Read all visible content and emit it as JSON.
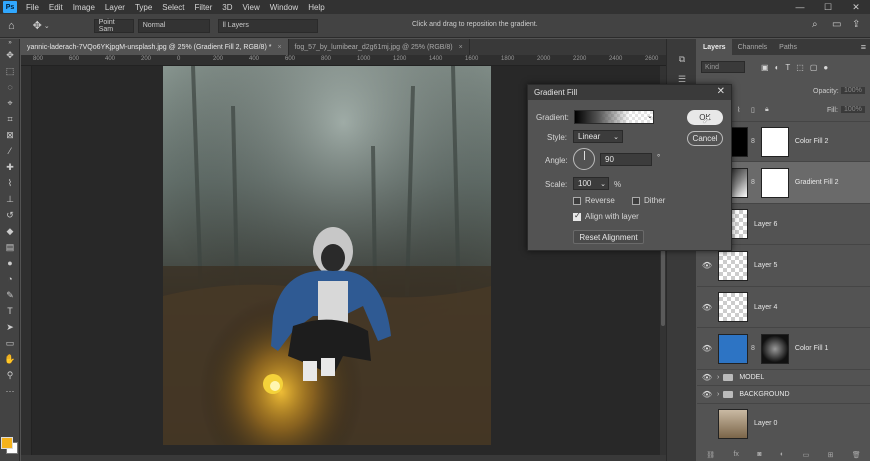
{
  "menubar": {
    "items": [
      "File",
      "Edit",
      "Image",
      "Layer",
      "Type",
      "Select",
      "Filter",
      "3D",
      "View",
      "Window",
      "Help"
    ],
    "app_logo": "Ps"
  },
  "options": {
    "sample_size": "Point Sam",
    "mode": "Normal",
    "sample_from": "ll Layers",
    "hint": "Click and drag to reposition the gradient."
  },
  "tabs": [
    {
      "label": "yannic-laderach-7VQo6YKjpgM-unsplash.jpg @ 25% (Gradient Fill 2, RGB/8) *",
      "close": "×"
    },
    {
      "label": "fog_57_by_lumibear_d2g61mj.jpg @ 25% (RGB/8)",
      "close": "×"
    }
  ],
  "ruler": {
    "ticks": [
      "800",
      "600",
      "400",
      "200",
      "0",
      "200",
      "400",
      "600",
      "800",
      "1000",
      "1200",
      "1400",
      "1600",
      "1800",
      "2000",
      "2200",
      "2400",
      "2600"
    ]
  },
  "dialog": {
    "title": "Gradient Fill",
    "close": "✕",
    "gradient_label": "Gradient:",
    "style_label": "Style:",
    "style_value": "Linear",
    "angle_label": "Angle:",
    "angle_value": "90",
    "angle_unit": "°",
    "scale_label": "Scale:",
    "scale_value": "100",
    "scale_unit": "%",
    "reverse_label": "Reverse",
    "dither_label": "Dither",
    "align_label": "Align with layer",
    "reset_label": "Reset Alignment",
    "ok_label": "OK",
    "cancel_label": "Cancel",
    "reverse_checked": false,
    "dither_checked": false,
    "align_checked": true
  },
  "layers_panel": {
    "tabs": [
      "Layers",
      "Channels",
      "Paths"
    ],
    "search_placeholder": "Kind",
    "opacity_label": "Opacity:",
    "opacity_value": "100%",
    "fill_label": "Fill:",
    "fill_value": "100%",
    "layers": [
      {
        "name": "Color Fill 2",
        "visible": false,
        "thumb": "black",
        "selected": false
      },
      {
        "name": "Gradient Fill 2",
        "visible": false,
        "thumb": "gradient",
        "selected": true
      },
      {
        "name": "Layer 6",
        "visible": true,
        "thumb": "checker",
        "selected": false
      },
      {
        "name": "Layer 5",
        "visible": true,
        "thumb": "checker",
        "selected": false
      },
      {
        "name": "Layer 4",
        "visible": true,
        "thumb": "checker",
        "selected": false
      },
      {
        "name": "Color Fill 1",
        "visible": true,
        "thumb": "blue",
        "selected": false
      },
      {
        "name": "MODEL",
        "visible": true,
        "thumb": "folder",
        "selected": false
      },
      {
        "name": "BACKGROUND",
        "visible": true,
        "thumb": "folder",
        "selected": false
      },
      {
        "name": "Layer 0",
        "visible": false,
        "thumb": "photo",
        "selected": false
      }
    ],
    "bottom_icons": [
      "link-icon",
      "fx-icon",
      "mask-icon",
      "adjustment-icon",
      "folder-icon",
      "new-layer-icon",
      "trash-icon"
    ]
  },
  "colors": {
    "accent": "#31a8ff",
    "foreground_swatch": "#f5b21b",
    "background_swatch": "#ffffff",
    "color_fill_1": "#2d74c4"
  }
}
